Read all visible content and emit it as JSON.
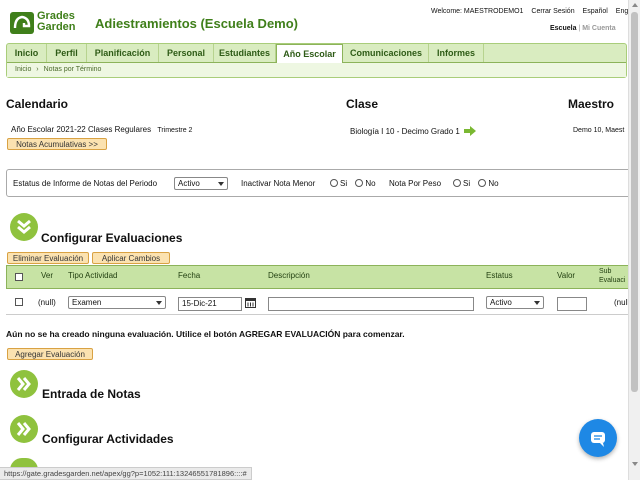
{
  "header": {
    "logo_line1": "Grades",
    "logo_line2": "Garden",
    "school_title": "Adiestramientos (Escuela Demo)",
    "welcome": "Welcome: MAESTRODEMO1",
    "logout": "Cerrar Sesión",
    "lang_es": "Español",
    "lang_en": "English",
    "link_school": "Escuela",
    "link_account": "Mi Cuenta"
  },
  "nav": {
    "tabs": [
      "Inicio",
      "Perfil",
      "Planificación",
      "Personal",
      "Estudiantes",
      "Año Escolar",
      "Comunicaciones",
      "Informes"
    ],
    "active_index": 5
  },
  "breadcrumb": {
    "home": "Inicio",
    "separator": "›",
    "current": "Notas por Término"
  },
  "info": {
    "calendar_heading": "Calendario",
    "class_heading": "Clase",
    "teacher_heading": "Maestro",
    "calendar_value": "Año Escolar 2021-22  Clases Regulares",
    "term": "Trimestre 2",
    "class_value": "Biología I 10 -  Decimo Grado  1",
    "teacher_value": "Demo 10, Maest",
    "cumulative_button": "Notas Acumulativas >>"
  },
  "status_bar": {
    "report_status_label": "Estatus de Informe de Notas del Periodo",
    "report_status_value": "Activo",
    "inactivate_label": "Inactivar Nota Menor",
    "by_weight_label": "Nota Por Peso",
    "yes": "Si",
    "no": "No"
  },
  "evaluations": {
    "title": "Configurar Evaluaciones",
    "delete_button": "Eliminar Evaluación",
    "apply_button": "Aplicar Cambios",
    "columns": {
      "view": "Ver",
      "type": "Tipo Actividad",
      "date": "Fecha",
      "description": "Descripción",
      "status": "Estatus",
      "value": "Valor",
      "sub_line1": "Sub",
      "sub_line2": "Evaluaci"
    },
    "row": {
      "view": "(null)",
      "type": "Examen",
      "date": "15-Dic-21",
      "description": "",
      "status": "Activo",
      "value": "",
      "sub": "(null"
    },
    "empty_message": "Aún no se ha creado ninguna evaluación. Utilice el botón AGREGAR EVALUACIÓN para comenzar.",
    "add_button": "Agregar Evaluación"
  },
  "sections": {
    "grades_entry": "Entrada de Notas",
    "activities": "Configurar Actividades"
  },
  "status_url": "https://gate.gradesgarden.net/apex/gg?p=1052:111:13246551781896::::#",
  "colors": {
    "brand_green": "#3f7f1a",
    "nav_green": "#d9ecc0",
    "icon_green": "#8fc23e",
    "button_orange": "#fbe2b0",
    "chat_blue": "#1e88e5"
  },
  "icons": {
    "forward_arrow": "»",
    "calendar": "calendar-icon",
    "chat": "chat-icon"
  }
}
